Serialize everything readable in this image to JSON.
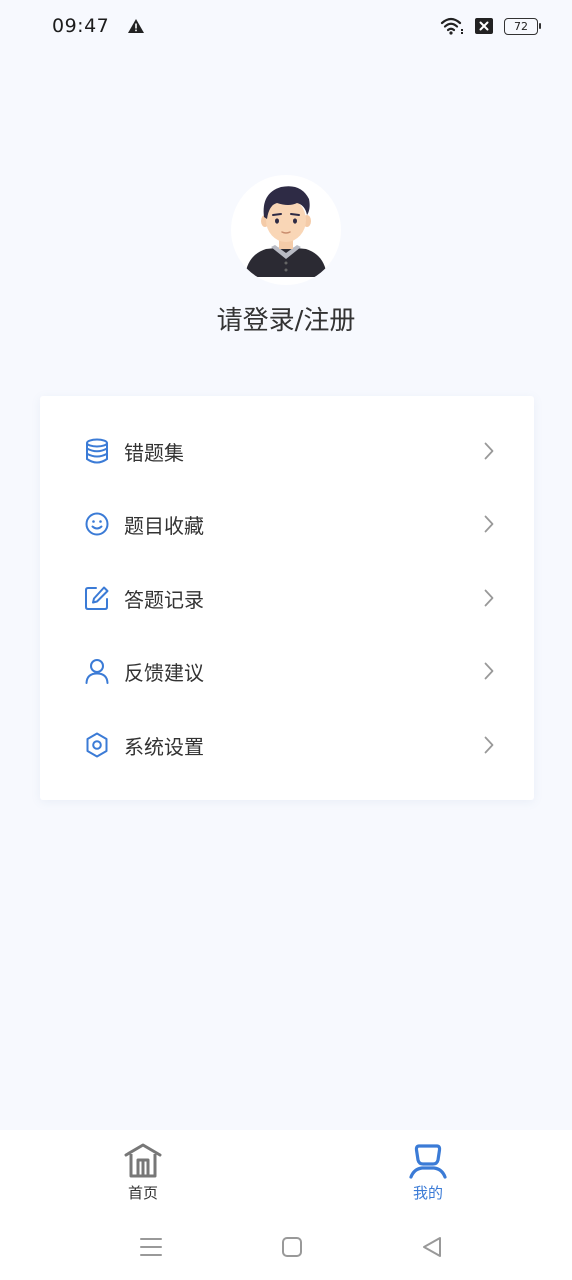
{
  "status_bar": {
    "time": "09:47",
    "battery_level": "72",
    "icons": [
      "alert-triangle-icon",
      "wifi-icon",
      "sim-blocked-icon",
      "battery-icon"
    ]
  },
  "profile": {
    "login_label": "请登录/注册",
    "avatar_icon": "user-avatar-illustration"
  },
  "menu": {
    "items": [
      {
        "label": "错题集",
        "icon": "database-icon"
      },
      {
        "label": "题目收藏",
        "icon": "smile-icon"
      },
      {
        "label": "答题记录",
        "icon": "edit-icon"
      },
      {
        "label": "反馈建议",
        "icon": "person-icon"
      },
      {
        "label": "系统设置",
        "icon": "settings-gear-icon"
      }
    ]
  },
  "tab_bar": {
    "tabs": [
      {
        "label": "首页",
        "icon": "home-icon",
        "active": false
      },
      {
        "label": "我的",
        "icon": "user-icon",
        "active": true
      }
    ]
  },
  "colors": {
    "accent": "#3b7bd6",
    "background": "#f7f9fe",
    "text": "#333333"
  }
}
